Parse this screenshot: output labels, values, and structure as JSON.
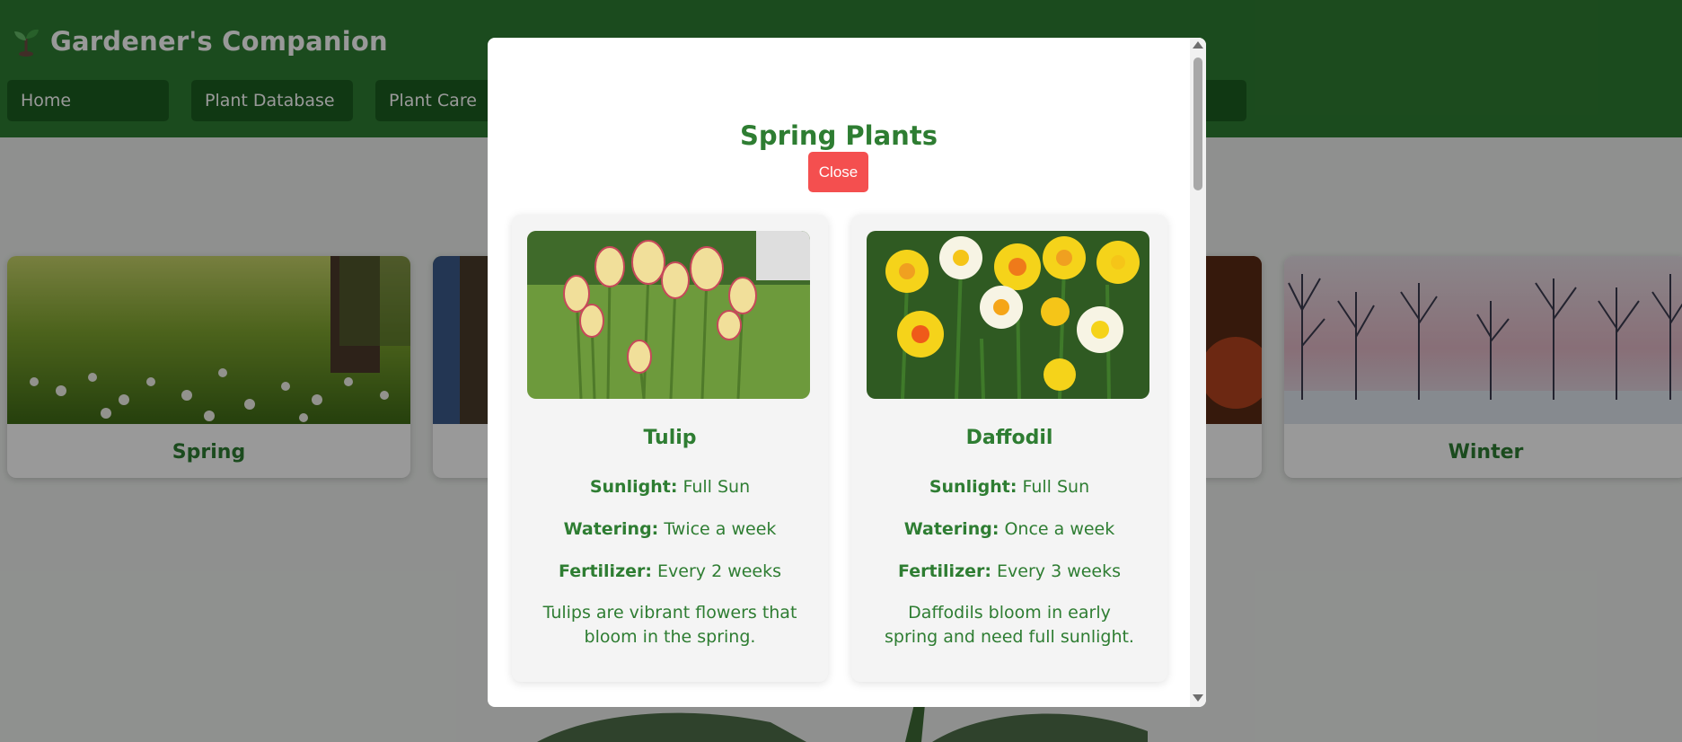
{
  "app": {
    "title": "Gardener's Companion",
    "logo_icon": "seedling-icon"
  },
  "nav": {
    "items": [
      {
        "label": "Home"
      },
      {
        "label": "Plant Database"
      },
      {
        "label": "Plant Care"
      }
    ]
  },
  "seasons": [
    {
      "label": "Spring",
      "image": "spring-meadow-photo"
    },
    {
      "label": "",
      "image": "summer-forest-photo"
    },
    {
      "label": "",
      "image": "autumn-foliage-photo"
    },
    {
      "label": "Winter",
      "image": "winter-trees-photo"
    }
  ],
  "modal": {
    "title": "Spring Plants",
    "close_label": "Close",
    "plants": [
      {
        "name": "Tulip",
        "image": "tulips-photo",
        "sunlight_label": "Sunlight:",
        "sunlight": "Full Sun",
        "watering_label": "Watering:",
        "watering": "Twice a week",
        "fertilizer_label": "Fertilizer:",
        "fertilizer": "Every 2 weeks",
        "description": "Tulips are vibrant flowers that bloom in the spring."
      },
      {
        "name": "Daffodil",
        "image": "daffodils-photo",
        "sunlight_label": "Sunlight:",
        "sunlight": "Full Sun",
        "watering_label": "Watering:",
        "watering": "Once a week",
        "fertilizer_label": "Fertilizer:",
        "fertilizer": "Every 3 weeks",
        "description": "Daffodils bloom in early spring and need full sunlight."
      }
    ]
  },
  "colors": {
    "header_bg": "#2e7d32",
    "nav_bg": "#1b5e20",
    "accent_text": "#2e7d32",
    "close_button": "#f44f4f"
  }
}
